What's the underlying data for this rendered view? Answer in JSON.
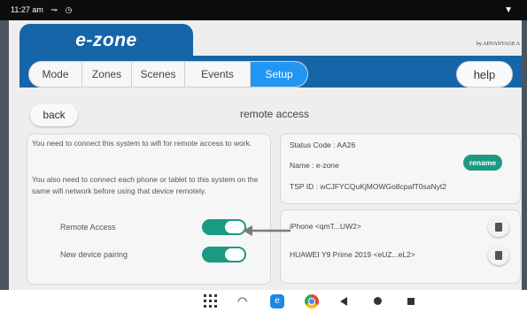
{
  "status_bar": {
    "time": "11:27 am",
    "icons": [
      "signal-icon",
      "clock-icon"
    ],
    "right_icon": "wifi-icon"
  },
  "brand": {
    "logo": "e-zone",
    "tagline": "by ADVANTAGE A"
  },
  "nav": {
    "tabs": [
      {
        "label": "Mode"
      },
      {
        "label": "Zones"
      },
      {
        "label": "Scenes"
      },
      {
        "label": "Events"
      },
      {
        "label": "Setup"
      }
    ],
    "active_tab": "Setup",
    "help_label": "help"
  },
  "page": {
    "back_label": "back",
    "title": "remote access"
  },
  "remote_info": {
    "text1": "You need to connect this system to wifi for remote access to work.",
    "text2": "You also need to connect each phone or tablet to this system on the same wifi network before using that device remotely.",
    "toggles": [
      {
        "label": "Remote Access",
        "on": true
      },
      {
        "label": "New device pairing",
        "on": true
      }
    ]
  },
  "status": {
    "status_code": "Status Code : AA26",
    "name": "Name : e-zone",
    "tsp_id": "TSP ID : wCJFYCQuKjMOWGo8cpafT0saNyt2",
    "rename_label": "rename"
  },
  "devices": [
    {
      "name": "iPhone <qmT...UW2>"
    },
    {
      "name": "HUAWEI Y9 Prime 2019 <eUZ...eL2>"
    }
  ],
  "colors": {
    "brand_blue": "#1565a8",
    "active_tab": "#2196f3",
    "toggle_green": "#1b9a82"
  }
}
